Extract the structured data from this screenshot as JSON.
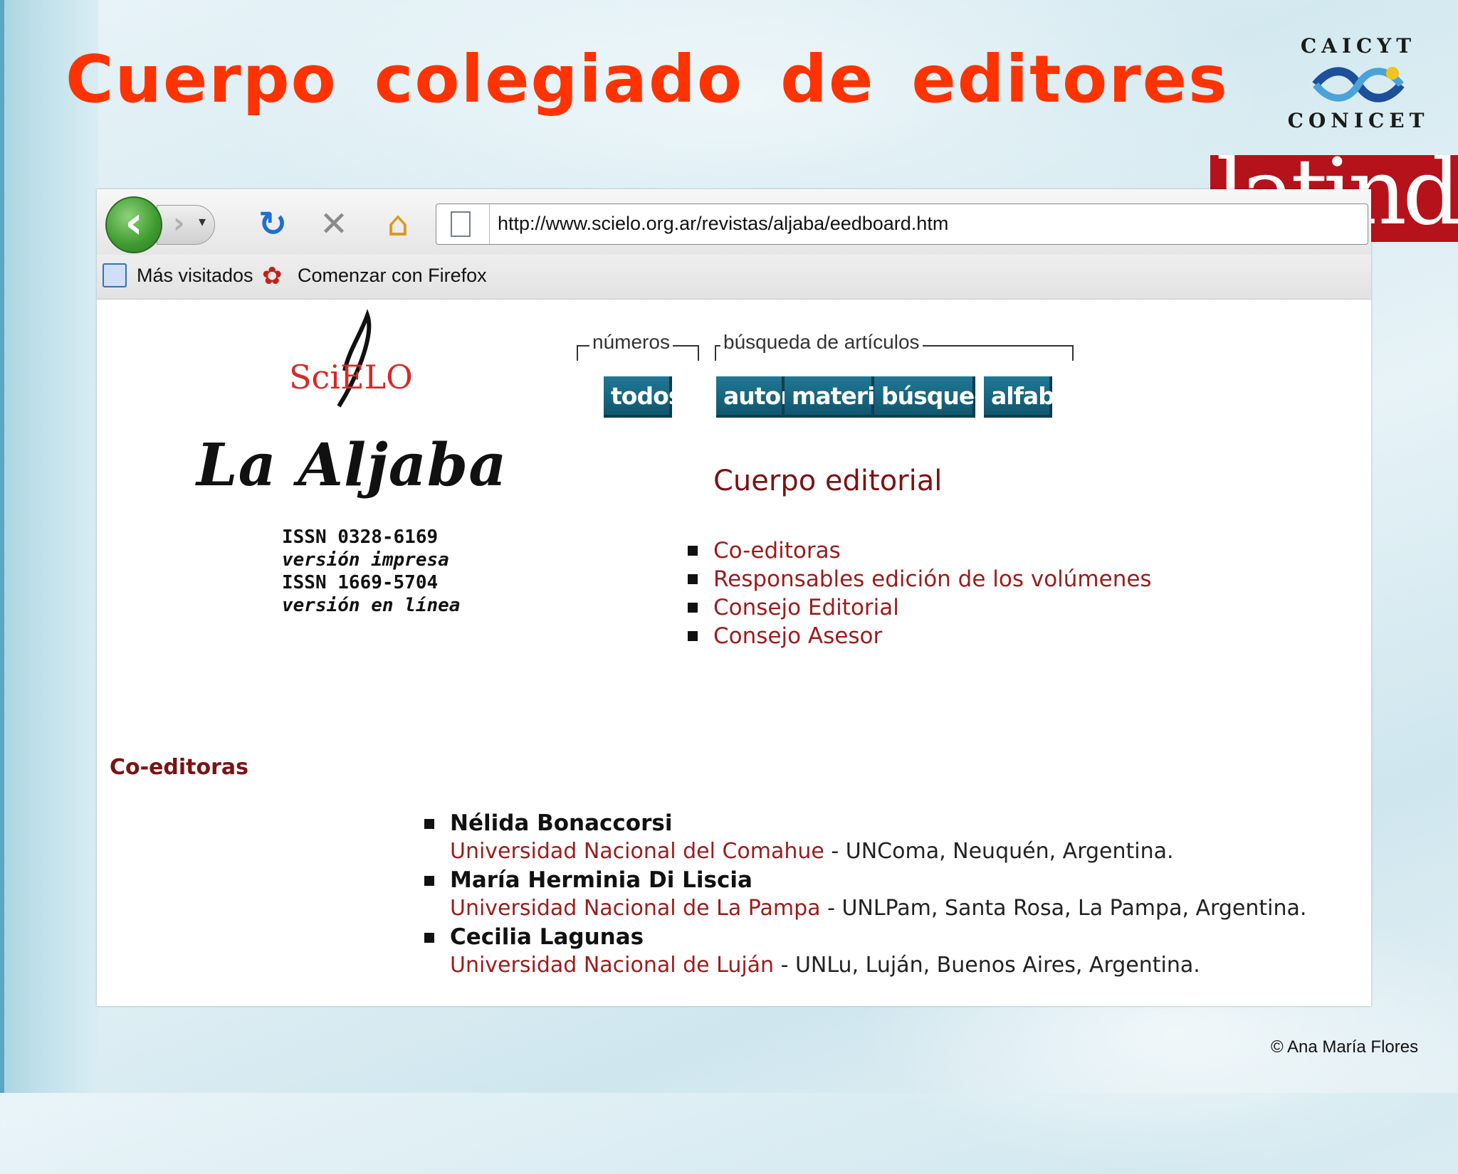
{
  "slide": {
    "title": "Cuerpo colegiado de editores",
    "copyright": "© Ana María Flores"
  },
  "logos": {
    "caicyt_top": "CAICYT",
    "caicyt_bottom": "CONICET",
    "latindex": "latindex"
  },
  "browser": {
    "url": "http://www.scielo.org.ar/revistas/aljaba/eedboard.htm",
    "bookmarks": [
      "Más visitados",
      "Comenzar con Firefox"
    ],
    "icons": {
      "back": "back-arrow-icon",
      "forward": "forward-arrow-icon",
      "reload": "reload-icon",
      "stop": "stop-icon",
      "home": "home-icon",
      "page": "page-icon"
    }
  },
  "page": {
    "scielo_logo": "SciELO",
    "journal_title": "La Aljaba",
    "issn_print": "ISSN 0328-6169",
    "issn_print_label": "versión impresa",
    "issn_online": "ISSN 1669-5704",
    "issn_online_label": "versión en línea",
    "nav_group_numbers": "números",
    "nav_group_search": "búsqueda de artículos",
    "nav_buttons": [
      "todos",
      "autor",
      "materia",
      "búsqueda",
      "alfab"
    ],
    "section_title": "Cuerpo editorial",
    "section_links": [
      "Co-editoras",
      "Responsables edición de los volúmenes",
      "Consejo Editorial",
      "Consejo Asesor"
    ],
    "coeditors_heading": "Co-editoras",
    "coeditors": [
      {
        "name": "Nélida Bonaccorsi",
        "university": "Universidad Nacional del Comahue",
        "detail": " - UNComa, Neuquén, Argentina."
      },
      {
        "name": "María Herminia Di Liscia",
        "university": "Universidad Nacional de La Pampa",
        "detail": " - UNLPam, Santa Rosa, La Pampa, Argentina."
      },
      {
        "name": "Cecilia Lagunas",
        "university": "Universidad Nacional de Luján",
        "detail": " - UNLu, Luján, Buenos Aires, Argentina."
      }
    ]
  },
  "colors": {
    "title": "#ff3300",
    "link": "#9b1c1c",
    "nav_button": "#1a6b86",
    "latindex_bg": "#b5121b"
  }
}
